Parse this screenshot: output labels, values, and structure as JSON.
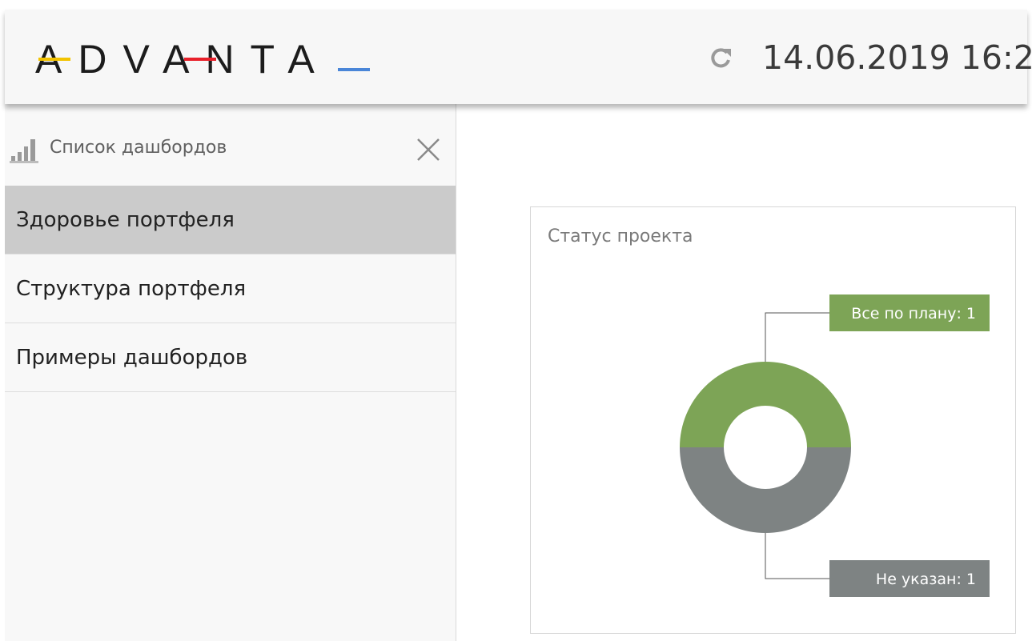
{
  "header": {
    "logo_text": "ADVANTA",
    "logo_letters": [
      "A",
      "D",
      "V",
      "A",
      "N",
      "T",
      "A"
    ],
    "logo_accent_colors": {
      "yellow": "#f2c300",
      "red": "#e8202a",
      "blue": "#4a86d8"
    },
    "refresh_icon": "refresh-icon",
    "datetime": "14.06.2019 16:2"
  },
  "sidebar": {
    "icon": "bar-chart-icon",
    "title": "Список дашбордов",
    "close_icon": "close-icon",
    "items": [
      {
        "label": "Здоровье портфеля",
        "active": true
      },
      {
        "label": "Структура портфеля",
        "active": false
      },
      {
        "label": "Примеры дашбордов",
        "active": false
      }
    ]
  },
  "card": {
    "title": "Статус проекта"
  },
  "chart_data": {
    "type": "pie",
    "donut": true,
    "title": "Статус проекта",
    "slices": [
      {
        "label": "Все по плану",
        "value": 1,
        "color": "#7da456",
        "data_label": "Все по плану: 1"
      },
      {
        "label": "Не указан",
        "value": 1,
        "color": "#7e8383",
        "data_label": "Не указан: 1"
      }
    ]
  }
}
